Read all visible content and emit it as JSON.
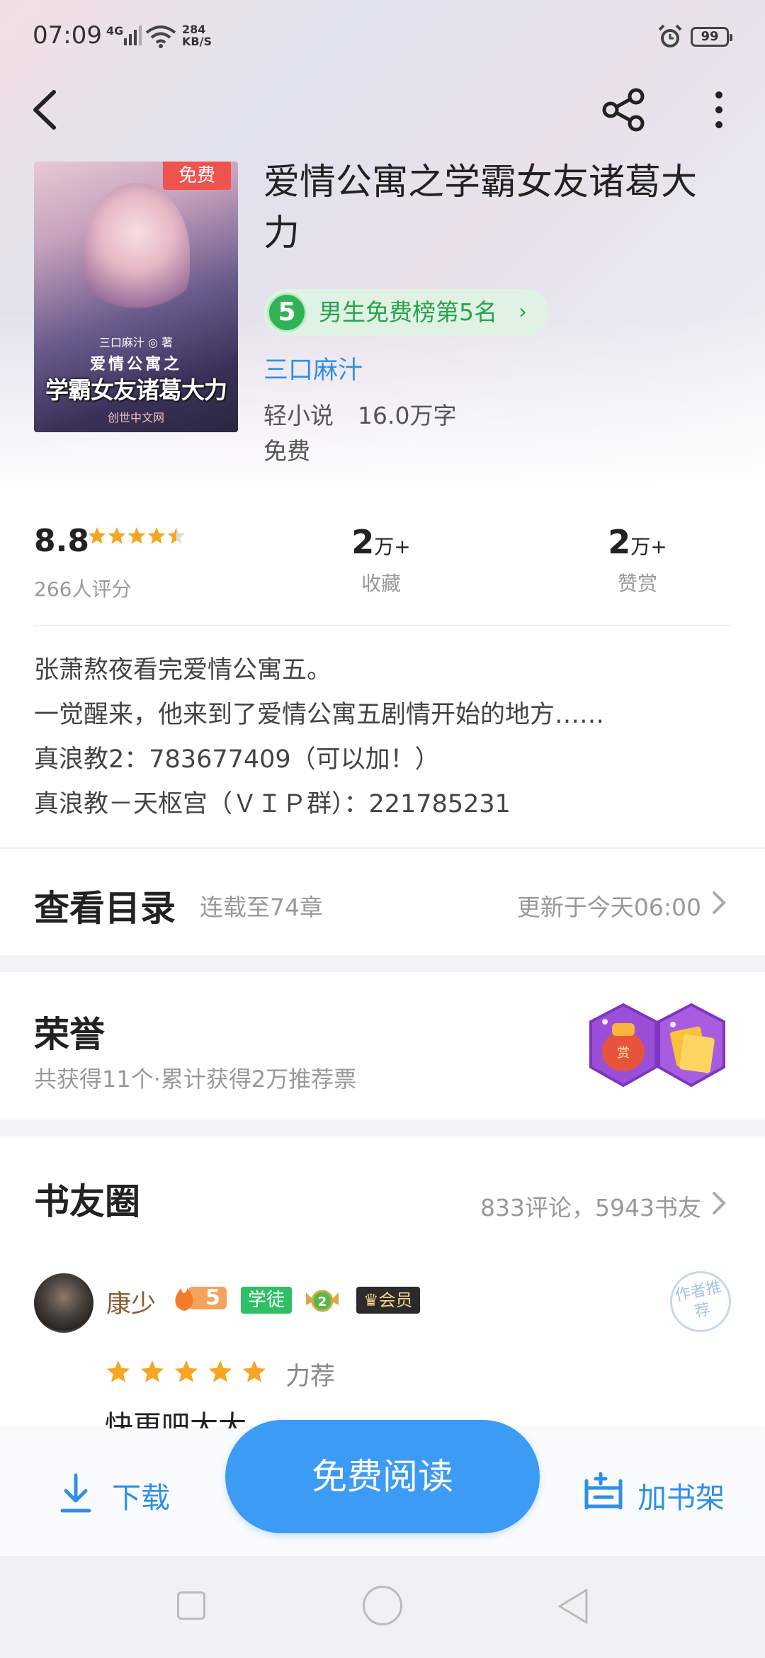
{
  "status_bar": {
    "time": "07:09",
    "network": "4G",
    "speed_value": "284",
    "speed_unit": "KB/S",
    "battery": "99"
  },
  "book": {
    "title": "爱情公寓之学霸女友诸葛大力",
    "cover": {
      "free_tag": "免费",
      "author_line": "三口麻汁 ◎ 著",
      "series_line": "爱情公寓之",
      "title_line": "学霸女友诸葛大力",
      "publisher": "创世中文网"
    },
    "rank": {
      "number": "5",
      "label": "男生免费榜第5名",
      "arrow": "›"
    },
    "author": "三口麻汁",
    "category": "轻小说",
    "word_count": "16.0万字",
    "price": "免费"
  },
  "stats": {
    "rating": "8.8",
    "rating_stars": 4.5,
    "rating_count": "266人评分",
    "collect_num": "2",
    "collect_unit": "万+",
    "collect_label": "收藏",
    "reward_num": "2",
    "reward_unit": "万+",
    "reward_label": "赞赏"
  },
  "intro": {
    "lines": [
      "张萧熬夜看完爱情公寓五。",
      "一觉醒来，他来到了爱情公寓五剧情开始的地方……",
      "真浪教2：783677409（可以加！）",
      "真浪教－天枢宫（ＶＩＰ群）：221785231"
    ]
  },
  "toc": {
    "title": "查看目录",
    "progress": "连载至74章",
    "updated": "更新于今天06:00"
  },
  "honor": {
    "title": "荣誉",
    "summary": "共获得11个·累计获得2万推荐票"
  },
  "circle": {
    "title": "书友圈",
    "stats": "833评论，5943书友"
  },
  "review": {
    "username": "康少",
    "fire_level": "5",
    "badge_xuetu": "学徒",
    "level_badge": "2",
    "vip_badge": "会员",
    "stamp": "作者推荐",
    "stars": 5,
    "tag": "力荐",
    "text_peek": "快更吧大大"
  },
  "bottom_bar": {
    "download_label": "下载",
    "read_label": "免费阅读",
    "shelf_label": "加书架"
  },
  "colors": {
    "accent_blue": "#3b9bf5",
    "rank_green": "#2fb356",
    "star_gold": "#f5a623",
    "free_red": "#f0524d"
  },
  "icons": [
    "back-icon",
    "share-icon",
    "more-icon",
    "star-icon",
    "chevron-right-icon",
    "download-icon",
    "bookshelf-icon",
    "fire-icon",
    "crown-icon"
  ]
}
